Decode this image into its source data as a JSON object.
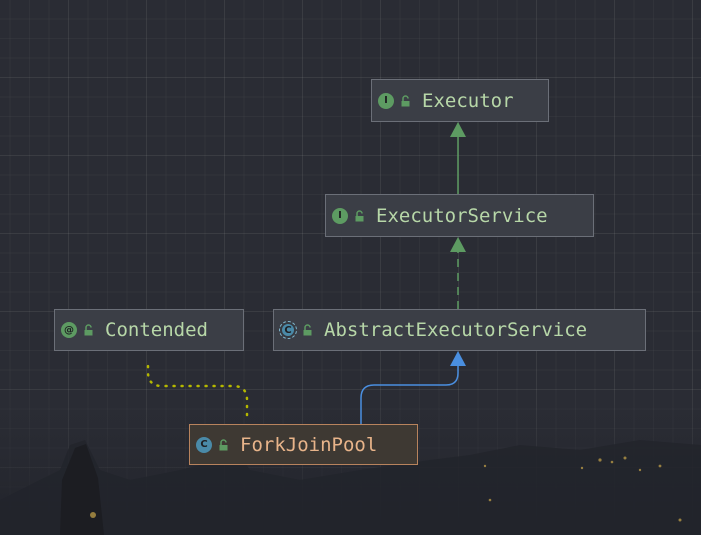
{
  "colors": {
    "background": "#2a2c34",
    "node_fill": "#3b3e46",
    "node_border": "#6b6f78",
    "node_text": "#b7d7a8",
    "selected_border": "#b8835d",
    "selected_text": "#e8b48a",
    "interface_edge": "#5d9b62",
    "extends_edge": "#4a8fe0",
    "annotation_edge": "#b5b800"
  },
  "nodes": [
    {
      "id": "executor",
      "label": "Executor",
      "kind": "interface",
      "kind_letter": "I",
      "access": "public-icon"
    },
    {
      "id": "executor-service",
      "label": "ExecutorService",
      "kind": "interface",
      "kind_letter": "I",
      "access": "public-icon"
    },
    {
      "id": "contended",
      "label": "Contended",
      "kind": "annotation",
      "kind_letter": "@",
      "access": "public-icon"
    },
    {
      "id": "abstract-executor-service",
      "label": "AbstractExecutorService",
      "kind": "abstract",
      "kind_letter": "C",
      "access": "public-icon"
    },
    {
      "id": "fork-join-pool",
      "label": "ForkJoinPool",
      "kind": "class",
      "kind_letter": "C",
      "access": "public-icon",
      "selected": true
    }
  ],
  "edges": [
    {
      "from": "executor-service",
      "to": "executor",
      "type": "extends-interface"
    },
    {
      "from": "abstract-executor-service",
      "to": "executor-service",
      "type": "implements"
    },
    {
      "from": "fork-join-pool",
      "to": "abstract-executor-service",
      "type": "extends"
    },
    {
      "from": "fork-join-pool",
      "to": "contended",
      "type": "annotated-by"
    }
  ]
}
